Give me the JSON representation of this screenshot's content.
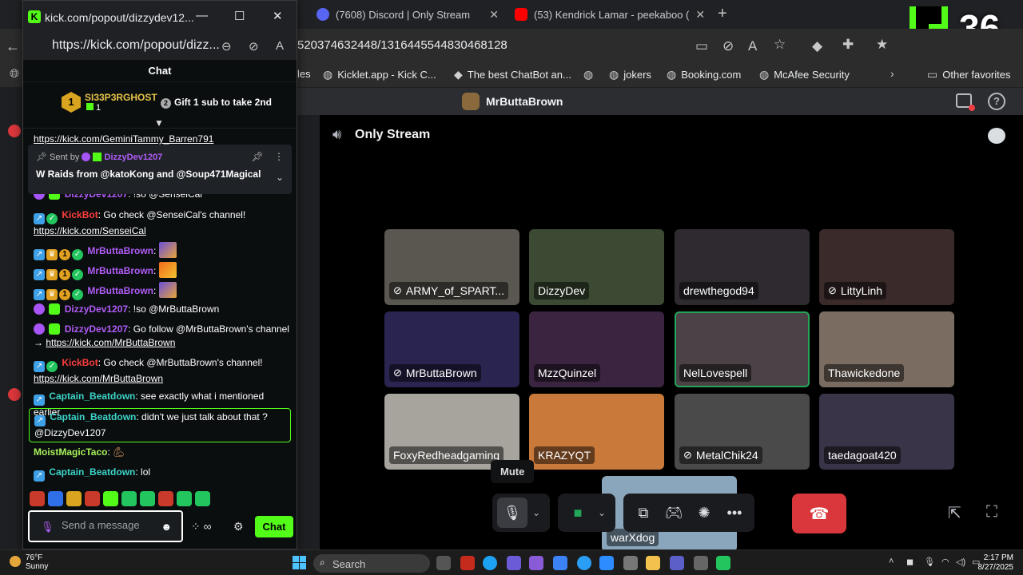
{
  "browser": {
    "tabs": [
      {
        "label": "(7608) Discord | Only Stream"
      },
      {
        "label": "(53) Kendrick Lamar - peekaboo ("
      }
    ],
    "url_fragment": "520374632448/1316445544830468128",
    "bookmarks": [
      "les",
      "Kicklet.app - Kick C...",
      "The best ChatBot an...",
      "jokers",
      "Booking.com",
      "McAfee Security"
    ],
    "other_favorites": "Other favorites",
    "overlay_number": "36"
  },
  "discord": {
    "server_name": "MrButtaBrown",
    "channel_name": "Only Stream",
    "participants": [
      {
        "name": "ARMY_of_SPART...",
        "muted": true,
        "bg": "#5a5650"
      },
      {
        "name": "DizzyDev",
        "muted": false,
        "bg": "#3c4a33"
      },
      {
        "name": "drewthegod94",
        "muted": false,
        "bg": "#2e2a30"
      },
      {
        "name": "LittyLinh",
        "muted": true,
        "bg": "#3a2a2a"
      },
      {
        "name": "MrButtaBrown",
        "muted": true,
        "bg": "#2a2550"
      },
      {
        "name": "MzzQuinzel",
        "muted": false,
        "bg": "#3a2440"
      },
      {
        "name": "NelLovespell",
        "muted": false,
        "bg": "#4a4246",
        "speaking": true
      },
      {
        "name": "Thawickedone",
        "muted": false,
        "bg": "#7a6c60"
      },
      {
        "name": "FoxyRedheadgaming",
        "muted": false,
        "bg": "#a7a39d"
      },
      {
        "name": "KRAZYQT",
        "muted": false,
        "bg": "#c9793a"
      },
      {
        "name": "MetalChik24",
        "muted": true,
        "bg": "#4a4a4a"
      },
      {
        "name": "taedagoat420",
        "muted": false,
        "bg": "#3a3448"
      },
      {
        "name": "warXdog",
        "muted": false,
        "bg": "#8aa6bc"
      }
    ],
    "tooltip": "Mute"
  },
  "popup": {
    "title": "kick.com/popout/dizzydev12...",
    "url": "https://kick.com/popout/dizz...",
    "chat_header": "Chat",
    "gifter": {
      "rank": "1",
      "name": "SI33P3RGHOST",
      "count": "1",
      "cta": "Gift 1 sub to take 2nd"
    },
    "pinned": {
      "sent_by_label": "Sent by",
      "sender": "DizzyDev1207",
      "text": "W Raids from @katoKong and @Soup471Magical"
    },
    "messages": {
      "m0": "https://kick.com/GeminiTammy_Barren791",
      "m1_user": "DizzyDev1207",
      "m1_text": ": !so @SenseiCal",
      "m2_user": "KickBot",
      "m2_text": ": Go check @SenseiCal's channel!",
      "m2_link": "https://kick.com/SenseiCal",
      "m3_user": "MrButtaBrown",
      "m3_text": ":",
      "m4_user": "MrButtaBrown",
      "m4_text": ":",
      "m5_user": "MrButtaBrown",
      "m5_text": ":",
      "m6_user": "DizzyDev1207",
      "m6_text": ": !so @MrButtaBrown",
      "m7_user": "DizzyDev1207",
      "m7_text": ": Go follow @MrButtaBrown's channel",
      "m7_arrow": "→",
      "m7_link": "https://kick.com/MrButtaBrown",
      "m8_user": "KickBot",
      "m8_text": ": Go check @MrButtaBrown's channel!",
      "m8_link": "https://kick.com/MrButtaBrown",
      "m9_user": "Captain_Beatdown",
      "m9_text": ": see exactly what i mentioned earlier",
      "m10_user": "Captain_Beatdown",
      "m10_text": ": didn't we just talk about that ?",
      "m10_mention": "@DizzyDev1207",
      "m11_user": "MoistMagicTaco",
      "m11_text": ":",
      "m12_user": "Captain_Beatdown",
      "m12_text": ": lol"
    },
    "input_placeholder": "Send a message",
    "chat_button": "Chat"
  },
  "taskbar": {
    "temp": "76°F",
    "condition": "Sunny",
    "search": "Search",
    "time": "2:17 PM",
    "date": "8/27/2025"
  }
}
